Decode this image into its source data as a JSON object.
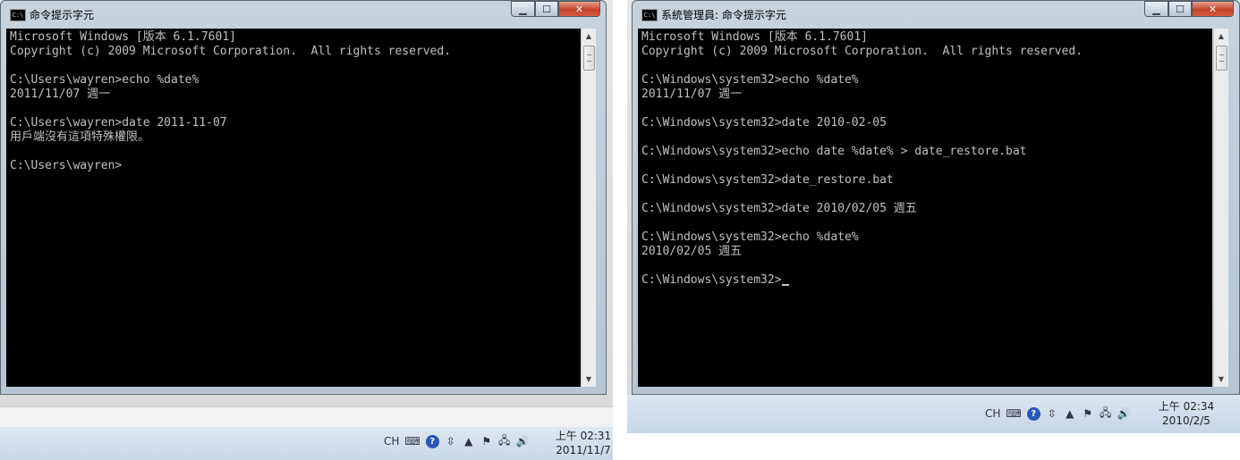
{
  "left_window": {
    "title": "命令提示字元",
    "icon_text": "C:\\",
    "console_lines": [
      "Microsoft Windows [版本 6.1.7601]",
      "Copyright (c) 2009 Microsoft Corporation.  All rights reserved.",
      "",
      "C:\\Users\\wayren>echo %date%",
      "2011/11/07 週一",
      "",
      "C:\\Users\\wayren>date 2011-11-07",
      "用戶端沒有這項特殊權限。",
      "",
      "C:\\Users\\wayren>"
    ]
  },
  "right_window": {
    "title": "系統管理員: 命令提示字元",
    "icon_text": "C:\\",
    "console_lines": [
      "Microsoft Windows [版本 6.1.7601]",
      "Copyright (c) 2009 Microsoft Corporation.  All rights reserved.",
      "",
      "C:\\Windows\\system32>echo %date%",
      "2011/11/07 週一",
      "",
      "C:\\Windows\\system32>date 2010-02-05",
      "",
      "C:\\Windows\\system32>echo date %date% > date_restore.bat",
      "",
      "C:\\Windows\\system32>date_restore.bat",
      "",
      "C:\\Windows\\system32>date 2010/02/05 週五",
      "",
      "C:\\Windows\\system32>echo %date%",
      "2010/02/05 週五",
      "",
      "C:\\Windows\\system32>"
    ]
  },
  "window_controls": {
    "minimize": "▁",
    "maximize": "☐",
    "close": "✕"
  },
  "scrollbar": {
    "up": "▲",
    "down": "▼"
  },
  "left_taskbar": {
    "language": "CH",
    "icons": {
      "keyboard": "⌨",
      "help": "?",
      "settings": "⇳",
      "show_hidden": "▲",
      "flag": "⚑",
      "network": "🖧",
      "volume": "🔊"
    },
    "clock_time": "上午 02:31",
    "clock_date": "2011/11/7"
  },
  "right_taskbar": {
    "language": "CH",
    "icons": {
      "keyboard": "⌨",
      "help": "?",
      "settings": "⇳",
      "show_hidden": "▲",
      "flag": "⚑",
      "network": "🖧",
      "volume": "🔊"
    },
    "clock_time": "上午 02:34",
    "clock_date": "2010/2/5"
  }
}
